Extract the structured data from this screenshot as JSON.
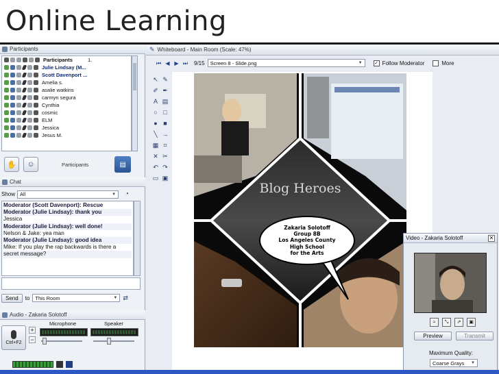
{
  "slide_title": "Online Learning",
  "participants": {
    "panel_title": "Participants",
    "list": [
      {
        "name": "Participants",
        "count": "1.",
        "style": "header"
      },
      {
        "name": "Julie Lindsay (M...",
        "style": "bold"
      },
      {
        "name": "Scott Davenport ...",
        "style": "bold"
      },
      {
        "name": "Amelia s.",
        "style": "normal"
      },
      {
        "name": "asalie watkins",
        "style": "normal"
      },
      {
        "name": "carmyn segura",
        "style": "normal"
      },
      {
        "name": "Cynthia",
        "style": "normal"
      },
      {
        "name": "cosmic",
        "style": "normal"
      },
      {
        "name": "ELM",
        "style": "normal"
      },
      {
        "name": "Jessica",
        "style": "normal"
      },
      {
        "name": "Jesus M.",
        "style": "normal"
      }
    ],
    "toolbar_label": "Participants"
  },
  "chat": {
    "panel_title": "Chat",
    "show_label": "Show",
    "show_value": "All",
    "messages": [
      {
        "text": "Moderator (Scott Davenport): Rescue",
        "style": "mod"
      },
      {
        "text": "Moderator (Julie Lindsay): thank you",
        "style": "mod"
      },
      {
        "text": "Jessica",
        "style": "normal"
      },
      {
        "text": "Moderator (Julie Lindsay): well done!",
        "style": "mod"
      },
      {
        "text": "Nelson & Jake: yea man",
        "style": "normal"
      },
      {
        "text": "Moderator (Julie Lindsay): good idea",
        "style": "mod"
      },
      {
        "text": "Mike: If you play the rap backwards is there a",
        "style": "normal"
      },
      {
        "text": "secret message?",
        "style": "normal"
      }
    ],
    "send_label": "Send",
    "to_label": "to",
    "to_value": "This Room"
  },
  "audio": {
    "panel_title": "Audio - Zakaria Solotoff",
    "talk_label": "Ctrl+F2",
    "microphone_label": "Microphone",
    "speaker_label": "Speaker"
  },
  "whiteboard": {
    "title": "Whiteboard - Main Room (Scale: 47%)",
    "page_indicator": "9/15",
    "page_select": "Screen 8 - Slide.png",
    "follow_label": "Follow Moderator",
    "more_label": "More"
  },
  "comic": {
    "title": "Blog Heroes",
    "bubble_lines": [
      "Zakaria Solotoff",
      "Group 8B",
      "Los Angeles County",
      "High School",
      "for the Arts"
    ]
  },
  "video": {
    "title": "Video - Zakaria Solotoff",
    "preview_label": "Preview",
    "transmit_label": "Transmit",
    "quality_label": "Maximum Quality:",
    "quality_value": "Coarse Grays"
  },
  "colors": {
    "title_rule": "#1a1a1a",
    "app_bg": "#e9edf3",
    "moderator_text": "#112a6b",
    "taskbar": "#2d58c4"
  }
}
